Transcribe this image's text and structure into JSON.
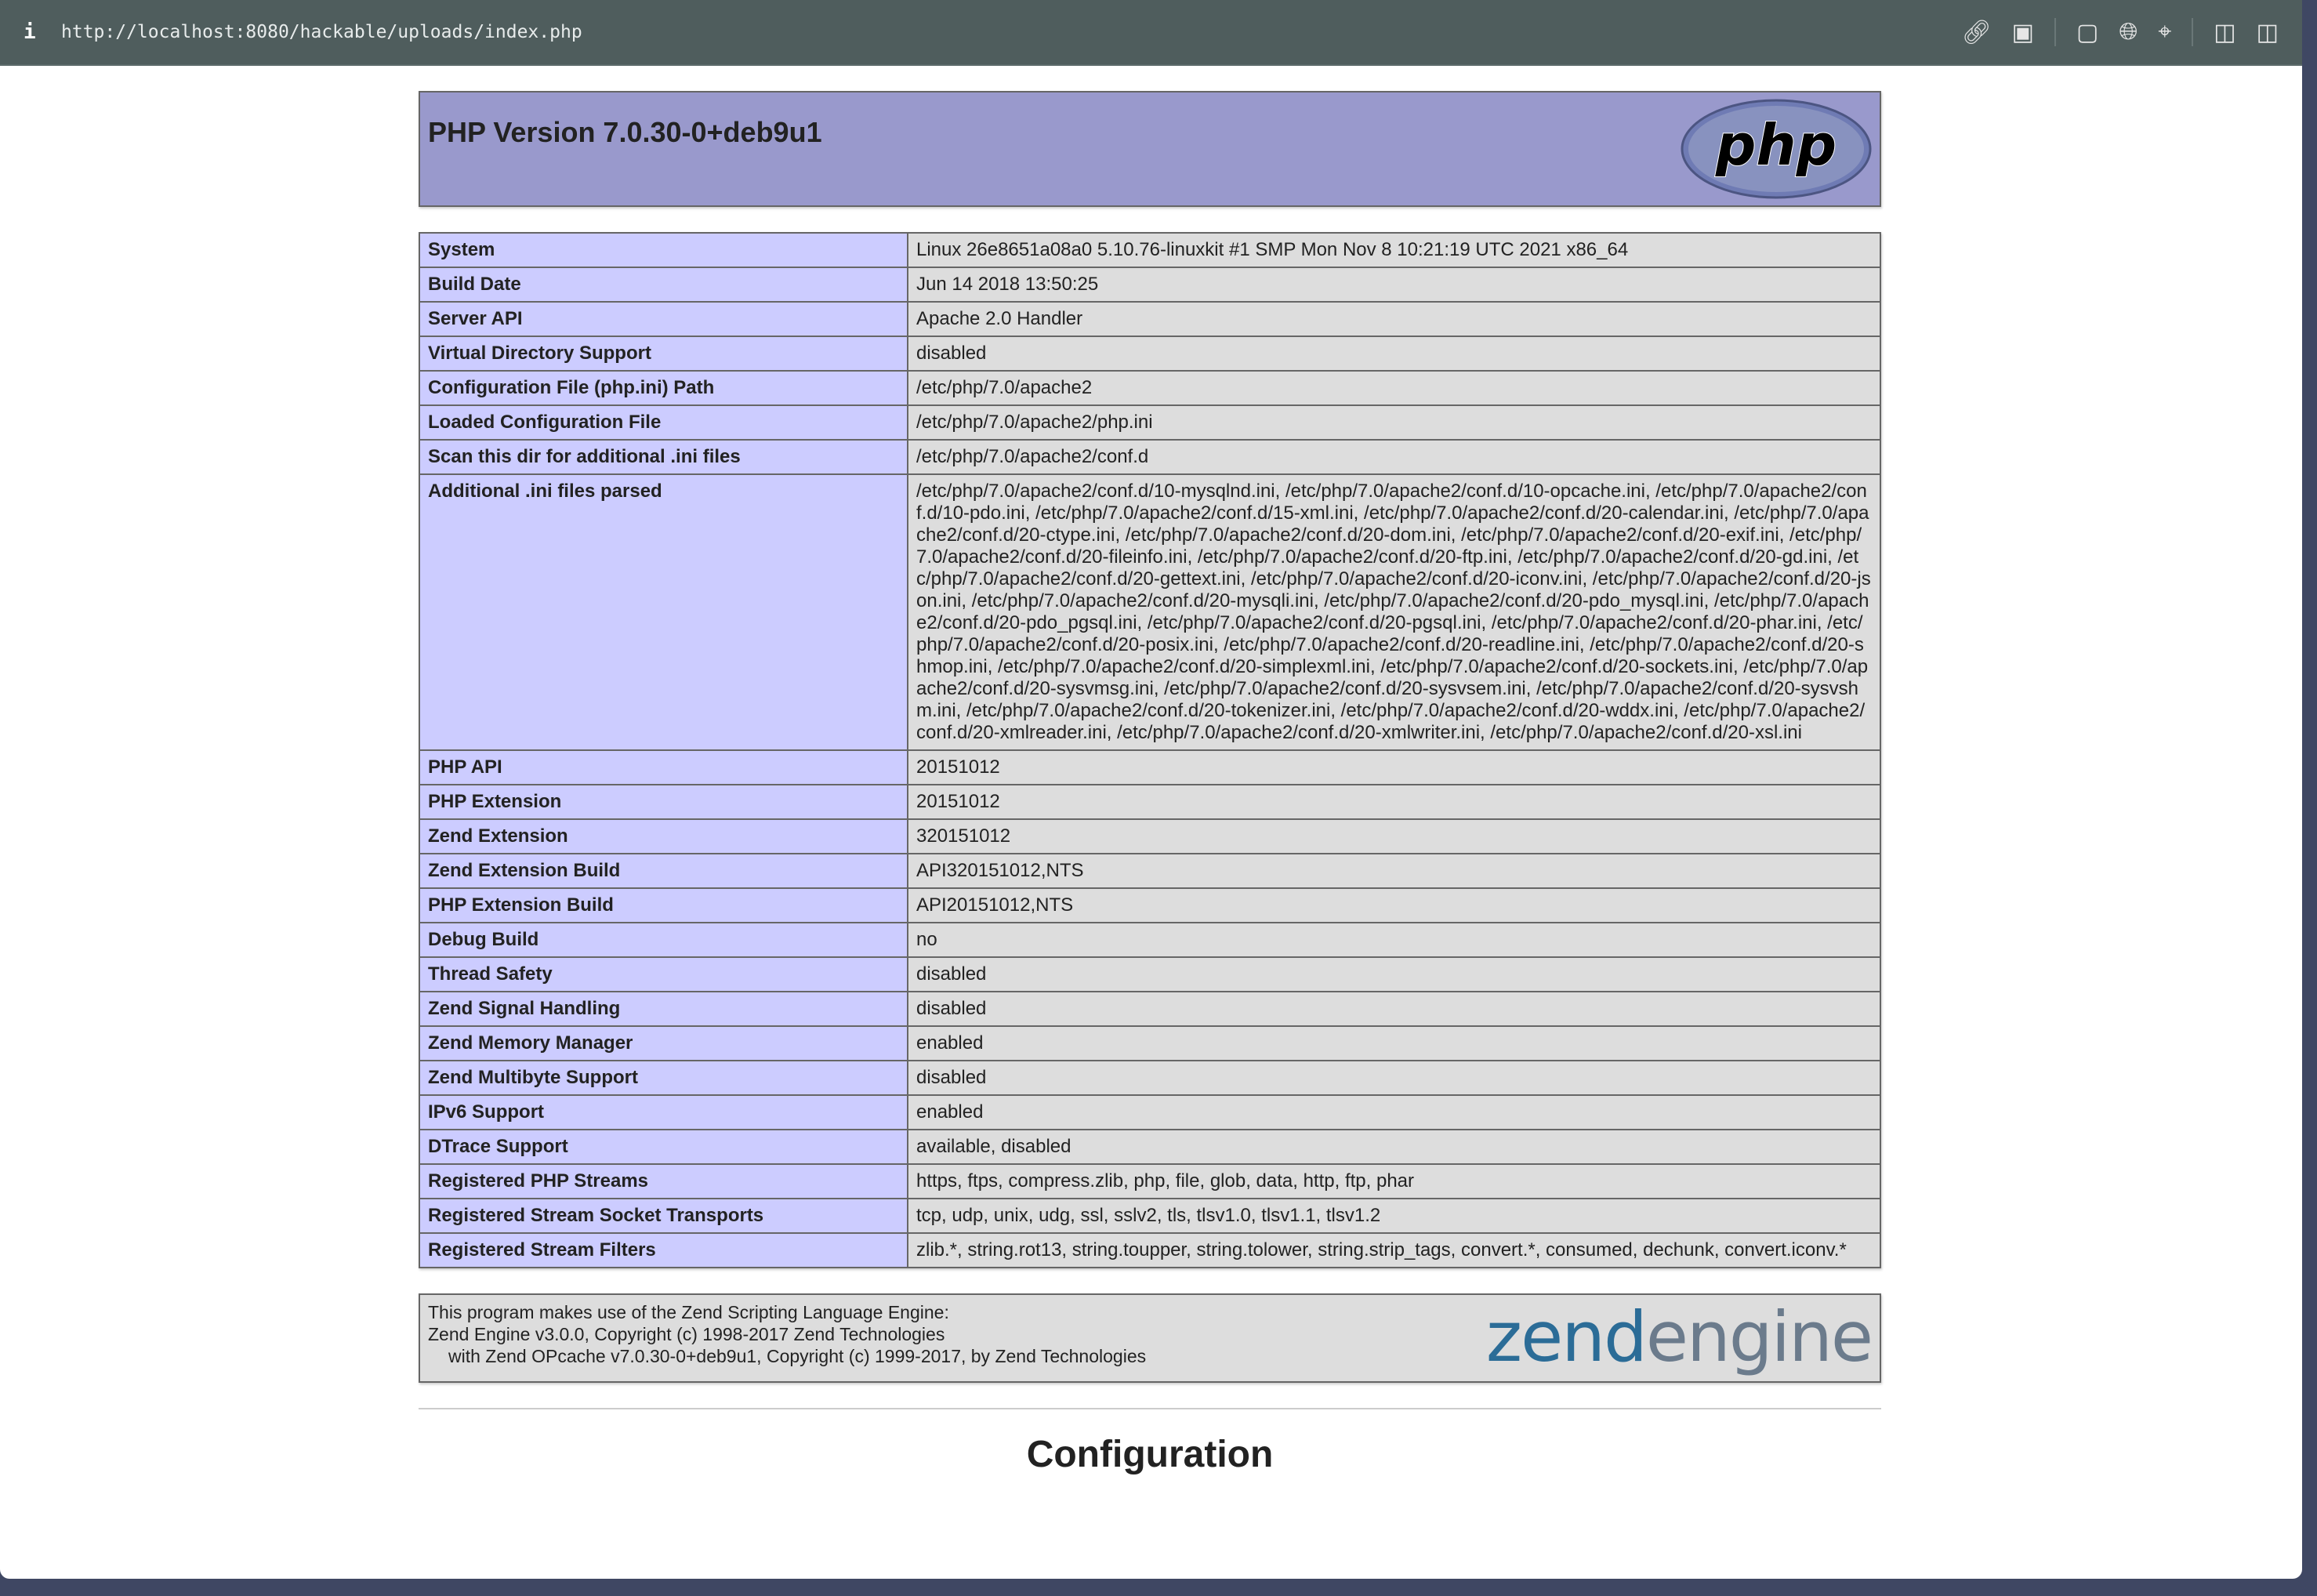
{
  "browser": {
    "url": "http://localhost:8080/hackable/uploads/index.php",
    "info_icon": "i"
  },
  "header": {
    "title": "PHP Version 7.0.30-0+deb9u1",
    "logo_text": "php"
  },
  "rows": [
    {
      "k": "System",
      "v": "Linux 26e8651a08a0 5.10.76-linuxkit #1 SMP Mon Nov 8 10:21:19 UTC 2021 x86_64"
    },
    {
      "k": "Build Date",
      "v": "Jun 14 2018 13:50:25"
    },
    {
      "k": "Server API",
      "v": "Apache 2.0 Handler"
    },
    {
      "k": "Virtual Directory Support",
      "v": "disabled"
    },
    {
      "k": "Configuration File (php.ini) Path",
      "v": "/etc/php/7.0/apache2"
    },
    {
      "k": "Loaded Configuration File",
      "v": "/etc/php/7.0/apache2/php.ini"
    },
    {
      "k": "Scan this dir for additional .ini files",
      "v": "/etc/php/7.0/apache2/conf.d"
    },
    {
      "k": "Additional .ini files parsed",
      "v": "/etc/php/7.0/apache2/conf.d/10-mysqlnd.ini, /etc/php/7.0/apache2/conf.d/10-opcache.ini, /etc/php/7.0/apache2/conf.d/10-pdo.ini, /etc/php/7.0/apache2/conf.d/15-xml.ini, /etc/php/7.0/apache2/conf.d/20-calendar.ini, /etc/php/7.0/apache2/conf.d/20-ctype.ini, /etc/php/7.0/apache2/conf.d/20-dom.ini, /etc/php/7.0/apache2/conf.d/20-exif.ini, /etc/php/7.0/apache2/conf.d/20-fileinfo.ini, /etc/php/7.0/apache2/conf.d/20-ftp.ini, /etc/php/7.0/apache2/conf.d/20-gd.ini, /etc/php/7.0/apache2/conf.d/20-gettext.ini, /etc/php/7.0/apache2/conf.d/20-iconv.ini, /etc/php/7.0/apache2/conf.d/20-json.ini, /etc/php/7.0/apache2/conf.d/20-mysqli.ini, /etc/php/7.0/apache2/conf.d/20-pdo_mysql.ini, /etc/php/7.0/apache2/conf.d/20-pdo_pgsql.ini, /etc/php/7.0/apache2/conf.d/20-pgsql.ini, /etc/php/7.0/apache2/conf.d/20-phar.ini, /etc/php/7.0/apache2/conf.d/20-posix.ini, /etc/php/7.0/apache2/conf.d/20-readline.ini, /etc/php/7.0/apache2/conf.d/20-shmop.ini, /etc/php/7.0/apache2/conf.d/20-simplexml.ini, /etc/php/7.0/apache2/conf.d/20-sockets.ini, /etc/php/7.0/apache2/conf.d/20-sysvmsg.ini, /etc/php/7.0/apache2/conf.d/20-sysvsem.ini, /etc/php/7.0/apache2/conf.d/20-sysvshm.ini, /etc/php/7.0/apache2/conf.d/20-tokenizer.ini, /etc/php/7.0/apache2/conf.d/20-wddx.ini, /etc/php/7.0/apache2/conf.d/20-xmlreader.ini, /etc/php/7.0/apache2/conf.d/20-xmlwriter.ini, /etc/php/7.0/apache2/conf.d/20-xsl.ini"
    },
    {
      "k": "PHP API",
      "v": "20151012"
    },
    {
      "k": "PHP Extension",
      "v": "20151012"
    },
    {
      "k": "Zend Extension",
      "v": "320151012"
    },
    {
      "k": "Zend Extension Build",
      "v": "API320151012,NTS"
    },
    {
      "k": "PHP Extension Build",
      "v": "API20151012,NTS"
    },
    {
      "k": "Debug Build",
      "v": "no"
    },
    {
      "k": "Thread Safety",
      "v": "disabled"
    },
    {
      "k": "Zend Signal Handling",
      "v": "disabled"
    },
    {
      "k": "Zend Memory Manager",
      "v": "enabled"
    },
    {
      "k": "Zend Multibyte Support",
      "v": "disabled"
    },
    {
      "k": "IPv6 Support",
      "v": "enabled"
    },
    {
      "k": "DTrace Support",
      "v": "available, disabled"
    },
    {
      "k": "Registered PHP Streams",
      "v": "https, ftps, compress.zlib, php, file, glob, data, http, ftp, phar"
    },
    {
      "k": "Registered Stream Socket Transports",
      "v": "tcp, udp, unix, udg, ssl, sslv2, tls, tlsv1.0, tlsv1.1, tlsv1.2"
    },
    {
      "k": "Registered Stream Filters",
      "v": "zlib.*, string.rot13, string.toupper, string.tolower, string.strip_tags, convert.*, consumed, dechunk, convert.iconv.*"
    }
  ],
  "zend": {
    "line1": "This program makes use of the Zend Scripting Language Engine:",
    "line2": "Zend Engine v3.0.0, Copyright (c) 1998-2017 Zend Technologies",
    "line3": "with Zend OPcache v7.0.30-0+deb9u1, Copyright (c) 1999-2017, by Zend Technologies",
    "logo_a": "zend",
    "logo_b": "engine"
  },
  "section_title": "Configuration"
}
